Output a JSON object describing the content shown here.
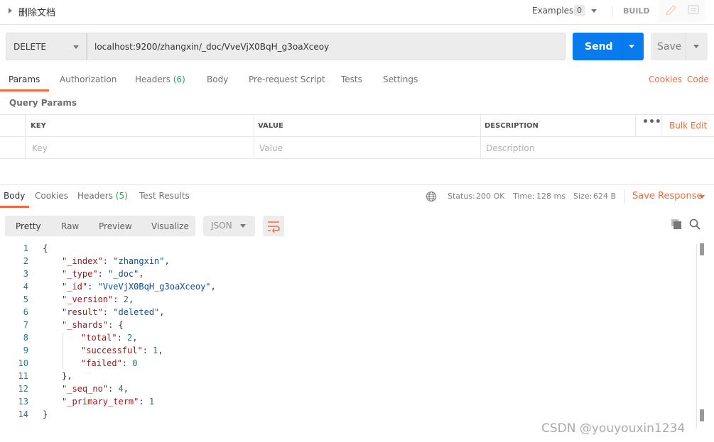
{
  "request": {
    "name": "删除文档",
    "examples_label": "Examples",
    "examples_count": "0",
    "build_label": "BUILD",
    "method": "DELETE",
    "url": "localhost:9200/zhangxin/_doc/VveVjX0BqH_g3oaXceoy",
    "send_label": "Send",
    "save_label": "Save"
  },
  "request_tabs": [
    {
      "label": "Params"
    },
    {
      "label": "Authorization"
    },
    {
      "label": "Headers",
      "count": "(6)"
    },
    {
      "label": "Body"
    },
    {
      "label": "Pre-request Script"
    },
    {
      "label": "Tests"
    },
    {
      "label": "Settings"
    }
  ],
  "links": {
    "cookies": "Cookies",
    "code": "Code"
  },
  "params": {
    "title": "Query Params",
    "headers": [
      "KEY",
      "VALUE",
      "DESCRIPTION"
    ],
    "bulk_edit": "Bulk Edit",
    "placeholders": [
      "Key",
      "Value",
      "Description"
    ]
  },
  "response_tabs": [
    {
      "label": "Body"
    },
    {
      "label": "Cookies"
    },
    {
      "label": "Headers",
      "count": "(5)"
    },
    {
      "label": "Test Results"
    }
  ],
  "status": {
    "status_label": "Status:",
    "status": "200 OK",
    "time_label": "Time:",
    "time": "128 ms",
    "size_label": "Size:",
    "size": "624 B",
    "save_response": "Save Response"
  },
  "view": {
    "modes": [
      "Pretty",
      "Raw",
      "Preview",
      "Visualize"
    ],
    "format": "JSON"
  },
  "body_lines": [
    [
      {
        "t": "p",
        "v": "{"
      }
    ],
    [
      {
        "t": "k",
        "v": "\"_index\""
      },
      {
        "t": "p",
        "v": ": "
      },
      {
        "t": "s",
        "v": "\"zhangxin\""
      },
      {
        "t": "p",
        "v": ","
      }
    ],
    [
      {
        "t": "k",
        "v": "\"_type\""
      },
      {
        "t": "p",
        "v": ": "
      },
      {
        "t": "s",
        "v": "\"_doc\""
      },
      {
        "t": "p",
        "v": ","
      }
    ],
    [
      {
        "t": "k",
        "v": "\"_id\""
      },
      {
        "t": "p",
        "v": ": "
      },
      {
        "t": "s",
        "v": "\"VveVjX0BqH_g3oaXceoy\""
      },
      {
        "t": "p",
        "v": ","
      }
    ],
    [
      {
        "t": "k",
        "v": "\"_version\""
      },
      {
        "t": "p",
        "v": ": "
      },
      {
        "t": "n",
        "v": "2"
      },
      {
        "t": "p",
        "v": ","
      }
    ],
    [
      {
        "t": "k",
        "v": "\"result\""
      },
      {
        "t": "p",
        "v": ": "
      },
      {
        "t": "s",
        "v": "\"deleted\""
      },
      {
        "t": "p",
        "v": ","
      }
    ],
    [
      {
        "t": "k",
        "v": "\"_shards\""
      },
      {
        "t": "p",
        "v": ": {"
      }
    ],
    [
      {
        "t": "k",
        "v": "\"total\""
      },
      {
        "t": "p",
        "v": ": "
      },
      {
        "t": "n",
        "v": "2"
      },
      {
        "t": "p",
        "v": ","
      }
    ],
    [
      {
        "t": "k",
        "v": "\"successful\""
      },
      {
        "t": "p",
        "v": ": "
      },
      {
        "t": "n",
        "v": "1"
      },
      {
        "t": "p",
        "v": ","
      }
    ],
    [
      {
        "t": "k",
        "v": "\"failed\""
      },
      {
        "t": "p",
        "v": ": "
      },
      {
        "t": "n",
        "v": "0"
      }
    ],
    [
      {
        "t": "p",
        "v": "},"
      }
    ],
    [
      {
        "t": "k",
        "v": "\"_seq_no\""
      },
      {
        "t": "p",
        "v": ": "
      },
      {
        "t": "n",
        "v": "4"
      },
      {
        "t": "p",
        "v": ","
      }
    ],
    [
      {
        "t": "k",
        "v": "\"_primary_term\""
      },
      {
        "t": "p",
        "v": ": "
      },
      {
        "t": "n",
        "v": "1"
      }
    ],
    [
      {
        "t": "p",
        "v": "}"
      }
    ]
  ],
  "indent": [
    0,
    1,
    1,
    1,
    1,
    1,
    1,
    2,
    2,
    2,
    1,
    1,
    1,
    0
  ],
  "watermark": "CSDN @youyouxin1234",
  "colors": {
    "accent": "#f26b3a",
    "send": "#097bed",
    "success": "#26a55a"
  }
}
